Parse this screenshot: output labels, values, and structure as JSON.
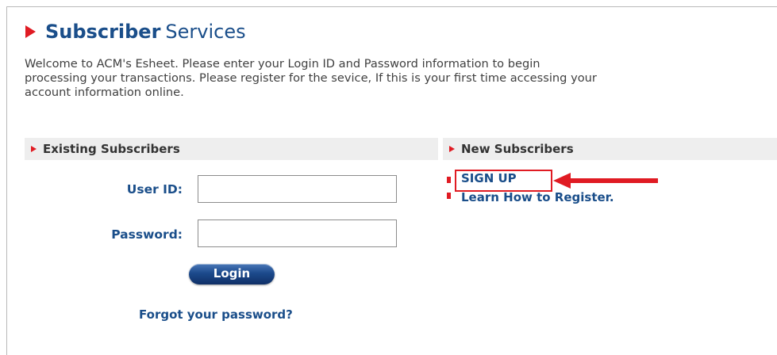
{
  "page": {
    "title_bold": "Subscriber",
    "title_rest": "Services",
    "intro_lines": [
      "Welcome to ACM's Esheet. Please enter your Login ID and Password information to begin",
      "processing your transactions. Please register for the sevice, If this is your first time accessing your",
      "account information online."
    ]
  },
  "existing": {
    "header": "Existing Subscribers",
    "user_id_label": "User ID:",
    "user_id_value": "",
    "password_label": "Password:",
    "password_value": "",
    "login_label": "Login",
    "forgot_label": "Forgot your password?"
  },
  "new_subscribers": {
    "header": "New Subscribers",
    "links": [
      "SIGN UP",
      "Learn How to Register."
    ]
  },
  "colors": {
    "accent_red": "#e01b23",
    "link_blue": "#1a4e8a",
    "header_bg": "#eeeeee"
  },
  "icons": {
    "title_marker": "red-triangle-icon",
    "section_marker": "small-red-triangle-icon",
    "link_bullet": "red-square-bullet-icon",
    "annotation": "red-arrow-icon"
  }
}
